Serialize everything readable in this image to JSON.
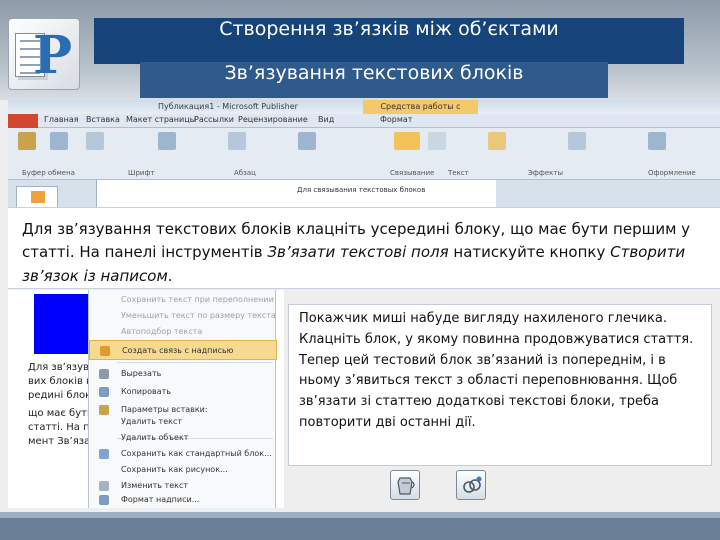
{
  "slide": {
    "title": "Створення зв’язків між об’єктами",
    "subtitle": "Зв’язування текстових блоків"
  },
  "instruction": {
    "part1": "Для зв’язування текстових блоків клацніть усередині блоку, що має бути першим у статті. На панелі інструментів ",
    "toolbar_name": "Зв’язати текстові поля",
    "part2": " натискуйте кнопку ",
    "button_name": "Створити зв’язок із написом",
    "part3": "."
  },
  "result_text": "Покажчик миші набуде вигляду нахиленого глечика. Клацніть блок, у якому повинна продовжуватися стаття. Тепер цей тестовий блок зв’язаний із попереднім, і в ньому з’явиться текст з області переповнювання. Щоб зв’язати зі статтею додаткові текстові блоки, треба повторити дві останні дії.",
  "ribbon": {
    "doc_title": "Публикация1 - Microsoft Publisher",
    "tools_label": "Средства работы с надписями",
    "tabs": [
      "Главная",
      "Вставка",
      "Макет страницы",
      "Рассылки",
      "Рецензирование",
      "Вид",
      "Формат"
    ],
    "groups": [
      "Буфер обмена",
      "Шрифт",
      "Абзац",
      "Связывание",
      "Текст",
      "Эффекты",
      "Оформление"
    ],
    "create_link_label": "Создать связь",
    "page_text": "Для связывания текстовых блоков"
  },
  "context_menu": {
    "items": [
      {
        "label": "Сохранить текст при переполнении",
        "dim": true
      },
      {
        "label": "Уменьшить текст по размеру текста",
        "dim": true
      },
      {
        "label": "Автоподбор текста",
        "dim": true
      },
      {
        "label": "Создать связь с надписью",
        "dim": false,
        "highlight": true
      },
      {
        "label": "Вырезать",
        "dim": false
      },
      {
        "label": "Копировать",
        "dim": false
      },
      {
        "label": "Параметры вставки:",
        "dim": false
      },
      {
        "label": "Удалить текст",
        "dim": false
      },
      {
        "label": "Удалить объект",
        "dim": false
      },
      {
        "label": "Сохранить как стандартный блок...",
        "dim": false
      },
      {
        "label": "Сохранить как рисунок...",
        "dim": false
      },
      {
        "label": "Изменить текст",
        "dim": false
      },
      {
        "label": "Формат надписи...",
        "dim": false
      }
    ]
  },
  "doc_fragments": [
    "Для зв’язування текстових",
    "вих блоків кла",
    "редині блоку,",
    "що має бути п",
    "статті. На пане",
    "мент Зв’язат"
  ],
  "colors": {
    "title_bg": "#15437a",
    "subtitle_bg": "#2f5a8c",
    "highlight": "#f7d98f",
    "text_block": "#0000ff"
  }
}
